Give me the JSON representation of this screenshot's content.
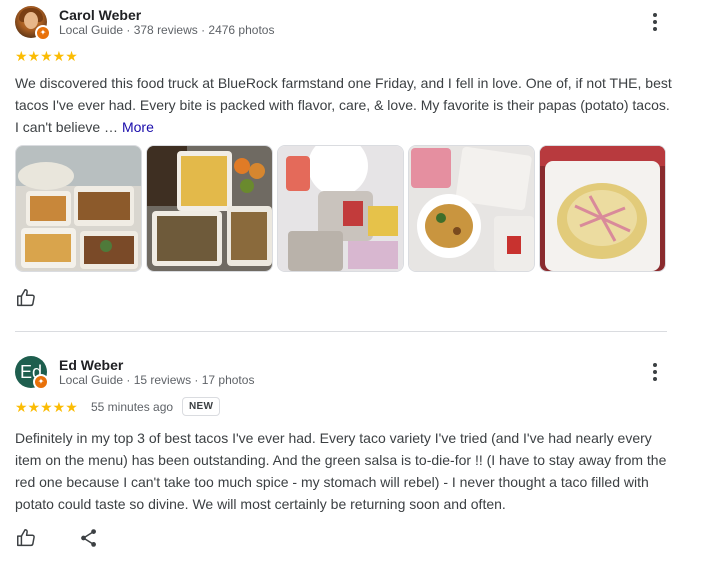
{
  "reviews": [
    {
      "author": "Carol Weber",
      "meta": "Local Guide · 378 reviews · 2476 photos",
      "stars": "★★★★★",
      "text": "We discovered this food truck at BlueRock farmstand one Friday, and I fell in love. One of, if not THE, best tacos I've ever had. Every bite is packed with flavor, care, & love. My favorite is their papas (potato) tacos. I can't believe …",
      "more_label": "More",
      "rating": 5,
      "photo_count": 5
    },
    {
      "author": "Ed Weber",
      "avatar_letters": "Ed",
      "meta": "Local Guide · 15 reviews · 17 photos",
      "stars": "★★★★★",
      "time": "55 minutes ago",
      "badge": "NEW",
      "text": "Definitely in my top 3 of best tacos I've ever had. Every taco variety I've tried (and I've had nearly every item on the menu) has been outstanding. And the green salsa is to-die-for !! (I have to stay away from the red one because I can't take too much spice - my stomach will rebel) - I never thought a taco filled with potato could taste so divine. We will most certainly be returning soon and often.",
      "rating": 5
    }
  ],
  "colors": {
    "star": "#fbbc04",
    "link": "#1a0dab",
    "guide_badge": "#e8710a",
    "avatar_bg": "#1e5e4e"
  }
}
